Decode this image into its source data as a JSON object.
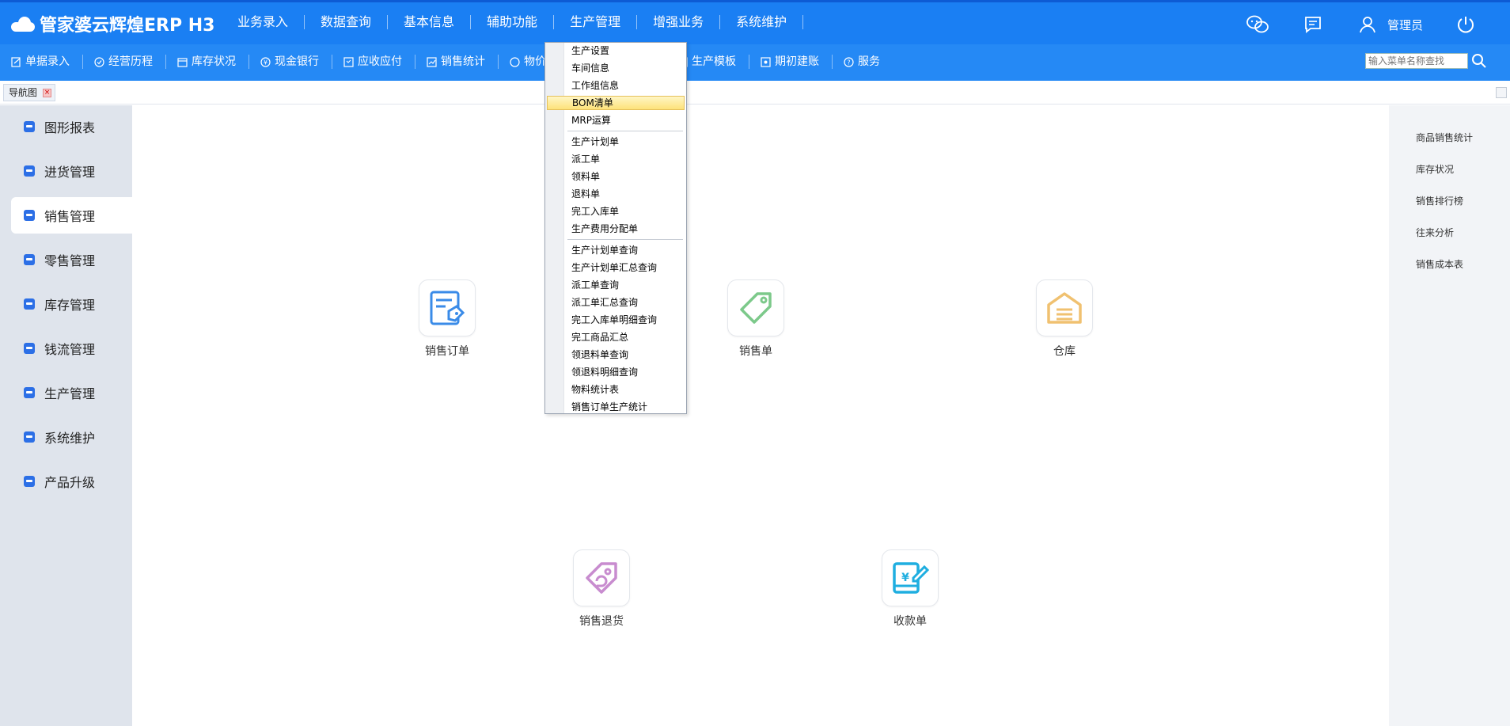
{
  "app": {
    "logo_text": "管家婆云辉煌ERP H3"
  },
  "topnav": [
    "业务录入",
    "数据查询",
    "基本信息",
    "辅助功能",
    "生产管理",
    "增强业务",
    "系统维护"
  ],
  "header_right": {
    "user_label": "管理员"
  },
  "toolbar": {
    "items": [
      "单据录入",
      "经营历程",
      "库存状况",
      "现金银行",
      "应收应付",
      "销售统计",
      "物价",
      "生产模板",
      "期初建账",
      "服务"
    ],
    "search_placeholder": "输入菜单名称查找"
  },
  "tabs": [
    {
      "label": "导航图"
    }
  ],
  "sidebar": {
    "items": [
      "图形报表",
      "进货管理",
      "销售管理",
      "零售管理",
      "库存管理",
      "钱流管理",
      "生产管理",
      "系统维护",
      "产品升级"
    ],
    "active_index": 2
  },
  "right_panel": {
    "items": [
      "商品销售统计",
      "库存状况",
      "销售排行榜",
      "往来分析",
      "销售成本表"
    ]
  },
  "tiles": [
    "销售订单",
    "销售单",
    "仓库",
    "销售退货",
    "收款单"
  ],
  "dropdown": {
    "group1": [
      "生产设置",
      "车间信息",
      "工作组信息",
      "BOM清单",
      "MRP运算"
    ],
    "group2": [
      "生产计划单",
      "派工单",
      "领料单",
      "退料单",
      "完工入库单",
      "生产费用分配单"
    ],
    "group3": [
      "生产计划单查询",
      "生产计划单汇总查询",
      "派工单查询",
      "派工单汇总查询",
      "完工入库单明细查询",
      "完工商品汇总",
      "领退料单查询",
      "领退料明细查询",
      "物料统计表",
      "销售订单生产统计"
    ],
    "highlighted": "BOM清单"
  },
  "colors": {
    "header_bg": "#1a7ff3",
    "toolbar_bg": "#2589f5",
    "sidebar_bg": "#dfe4ec",
    "tile_blue": "#3a8be8",
    "tile_green": "#7cc98a",
    "tile_orange": "#f0c170",
    "tile_purple": "#c88ccf",
    "tile_cyan": "#1faee0"
  }
}
